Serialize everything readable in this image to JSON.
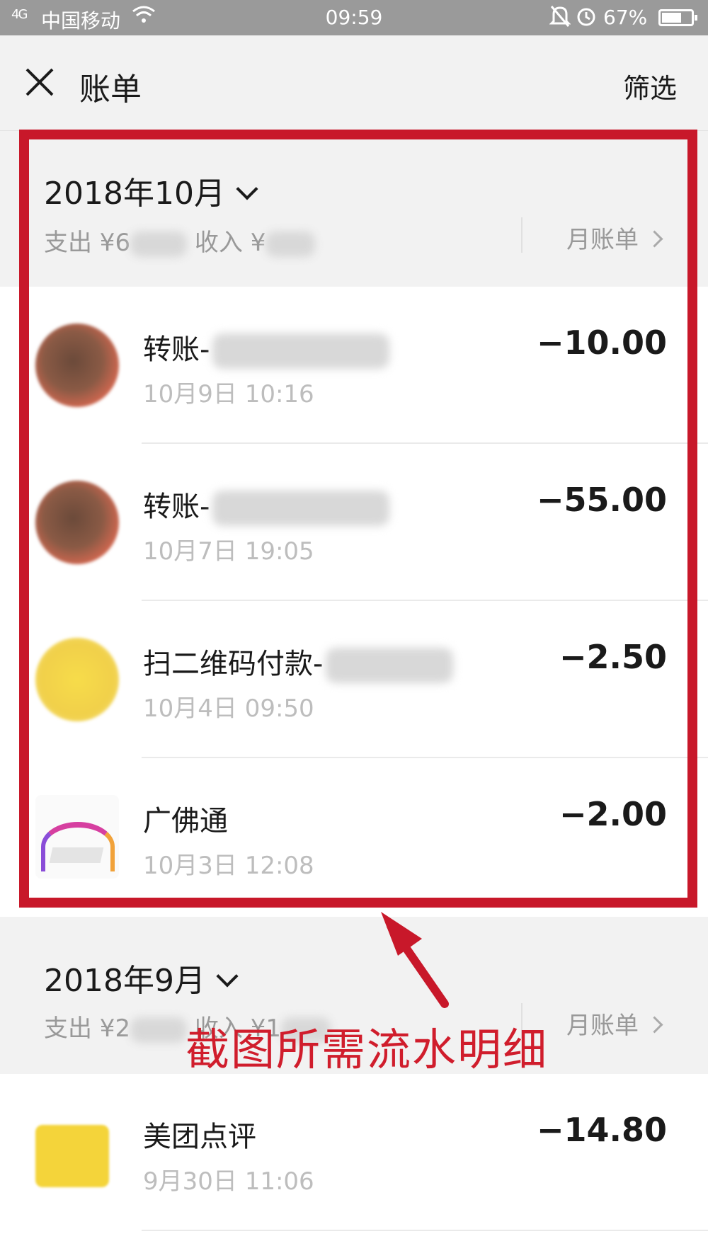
{
  "status_bar": {
    "network": "4G",
    "carrier": "中国移动",
    "time": "09:59",
    "battery": "67%",
    "battery_level": 0.67,
    "icons": [
      "signal-icon",
      "wifi-icon",
      "bell-off-icon",
      "alarm-icon",
      "battery-icon"
    ]
  },
  "header": {
    "close_icon": "close-icon",
    "title": "账单",
    "filter_label": "筛选"
  },
  "months": [
    {
      "title": "2018年10月",
      "expense_label": "支出 ¥6",
      "income_label": "收入 ¥",
      "monthly_bill_label": "月账单",
      "transactions": [
        {
          "name": "转账-",
          "time": "10月9日 10:16",
          "amount": "−10.00",
          "avatar": "avatar-blurred"
        },
        {
          "name": "转账-",
          "time": "10月7日 19:05",
          "amount": "−55.00",
          "avatar": "avatar-blurred"
        },
        {
          "name": "扫二维码付款-",
          "time": "10月4日 09:50",
          "amount": "−2.50",
          "avatar": "avatar-yellow"
        },
        {
          "name": "广佛通",
          "time": "10月3日 12:08",
          "amount": "−2.00",
          "avatar": "guangfotong-logo"
        }
      ]
    },
    {
      "title": "2018年9月",
      "expense_label": "支出 ¥2",
      "income_label": "收入 ¥1",
      "monthly_bill_label": "月账单",
      "transactions": [
        {
          "name": "美团点评",
          "time": "9月30日 11:06",
          "amount": "−14.80",
          "avatar": "meituan-logo"
        }
      ]
    }
  ],
  "annotation": {
    "text": "截图所需流水明细",
    "color": "#d01d2c"
  }
}
